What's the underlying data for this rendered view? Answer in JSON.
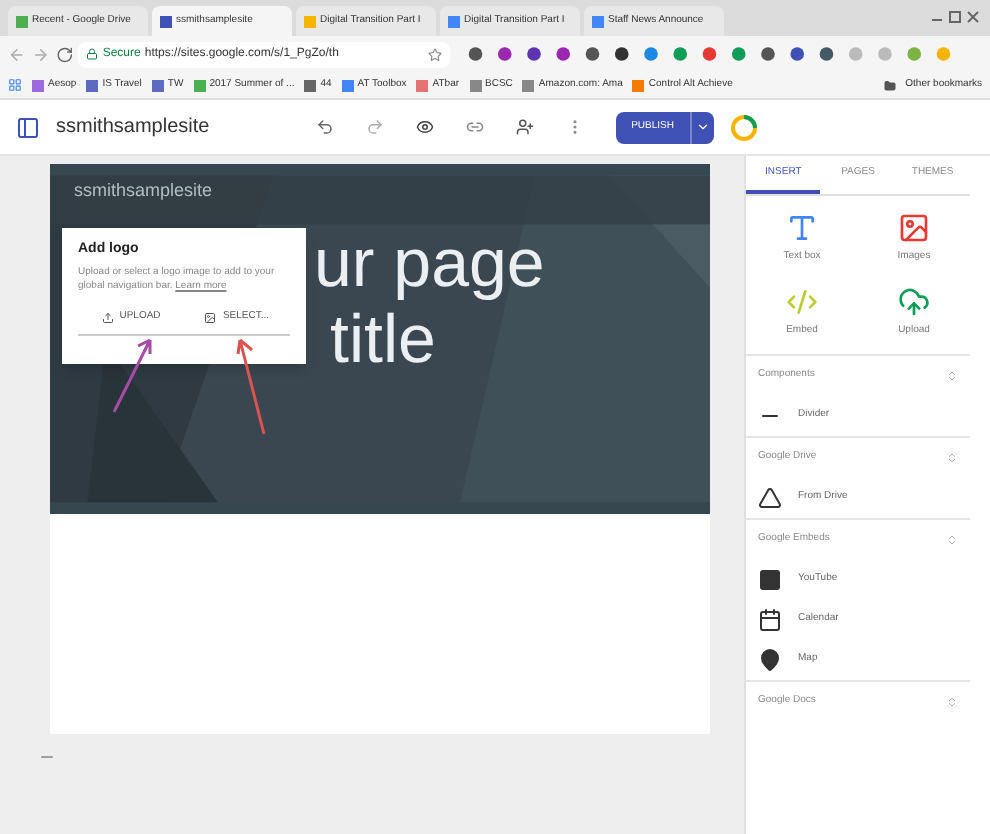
{
  "browser": {
    "tabs": [
      {
        "label": "Recent - Google Drive",
        "selected": false,
        "color": "#4caf50"
      },
      {
        "label": "ssmithsamplesite",
        "selected": true,
        "color": "#3f51b5"
      },
      {
        "label": "Digital Transition Part I",
        "selected": false,
        "color": "#f4b400"
      },
      {
        "label": "Digital Transition Part I",
        "selected": false,
        "color": "#4285f4"
      },
      {
        "label": "Staff News Announce",
        "selected": false,
        "color": "#4285f4"
      }
    ],
    "secure_label": "Secure",
    "url": "https://sites.google.com/s/1_PgZo/th",
    "bookmarks": [
      {
        "label": "Aesop",
        "color": "#9c6ade"
      },
      {
        "label": "IS Travel",
        "color": "#5c6bc0"
      },
      {
        "label": "TW",
        "color": "#5c6bc0"
      },
      {
        "label": "2017 Summer of ...",
        "color": "#4caf50"
      },
      {
        "label": "44",
        "color": "#666666"
      },
      {
        "label": "AT Toolbox",
        "color": "#4285f4"
      },
      {
        "label": "ATbar",
        "color": "#e57373"
      },
      {
        "label": "BCSC",
        "color": "#888888"
      },
      {
        "label": "Amazon.com: Ama",
        "color": "#888888"
      },
      {
        "label": "Control Alt Achieve",
        "color": "#f57c00"
      }
    ],
    "other_bookmarks": "Other bookmarks"
  },
  "app": {
    "site_name": "ssmithsamplesite",
    "publish": "PUBLISH"
  },
  "page": {
    "nav_title": "ssmithsamplesite",
    "title_lines": [
      "ur page",
      "title"
    ]
  },
  "logo_popup": {
    "title": "Add logo",
    "text": "Upload or select a logo image to add to your global navigation bar.",
    "link": "Learn more",
    "buttons": [
      {
        "kind": "upload",
        "label": "UPLOAD"
      },
      {
        "kind": "select",
        "label": "SELECT..."
      }
    ]
  },
  "panel": {
    "tabs": [
      {
        "label": "INSERT",
        "selected": true
      },
      {
        "label": "PAGES",
        "selected": false
      },
      {
        "label": "THEMES",
        "selected": false
      }
    ],
    "tiles": [
      {
        "kind": "text",
        "label": "Text box"
      },
      {
        "kind": "images",
        "label": "Images"
      },
      {
        "kind": "embed",
        "label": "Embed"
      },
      {
        "kind": "upload",
        "label": "Upload"
      }
    ],
    "sections": [
      {
        "title": "Components",
        "items": [
          {
            "kind": "divider",
            "label": "Divider"
          }
        ]
      },
      {
        "title": "Google Drive",
        "items": [
          {
            "kind": "drive",
            "label": "From Drive"
          }
        ]
      },
      {
        "title": "Google Embeds",
        "items": [
          {
            "kind": "youtube",
            "label": "YouTube"
          },
          {
            "kind": "calendar",
            "label": "Calendar"
          },
          {
            "kind": "map",
            "label": "Map"
          }
        ]
      },
      {
        "title": "Google Docs"
      }
    ]
  }
}
